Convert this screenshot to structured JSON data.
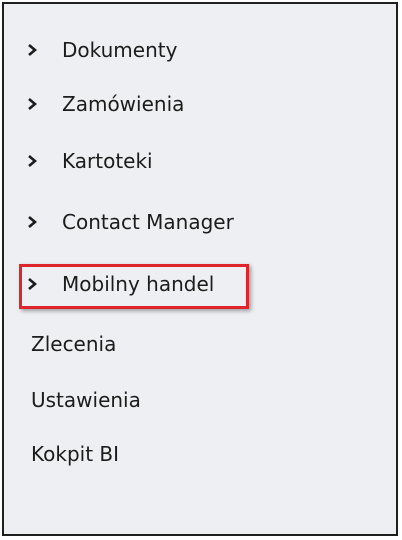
{
  "menu": {
    "expandable": [
      {
        "label": "Dokumenty",
        "icon": "chevron-right-icon"
      },
      {
        "label": "Zamówienia",
        "icon": "chevron-right-icon"
      },
      {
        "label": "Kartoteki",
        "icon": "chevron-right-icon"
      },
      {
        "label": "Contact Manager",
        "icon": "chevron-right-icon"
      },
      {
        "label": "Mobilny handel",
        "icon": "chevron-right-icon"
      }
    ],
    "plain": [
      {
        "label": "Zlecenia"
      },
      {
        "label": "Ustawienia"
      },
      {
        "label": "Kokpit BI"
      }
    ]
  },
  "colors": {
    "panel_background": "#eeeff2",
    "highlight_border": "#e0242c",
    "text": "#1c1c1c"
  }
}
